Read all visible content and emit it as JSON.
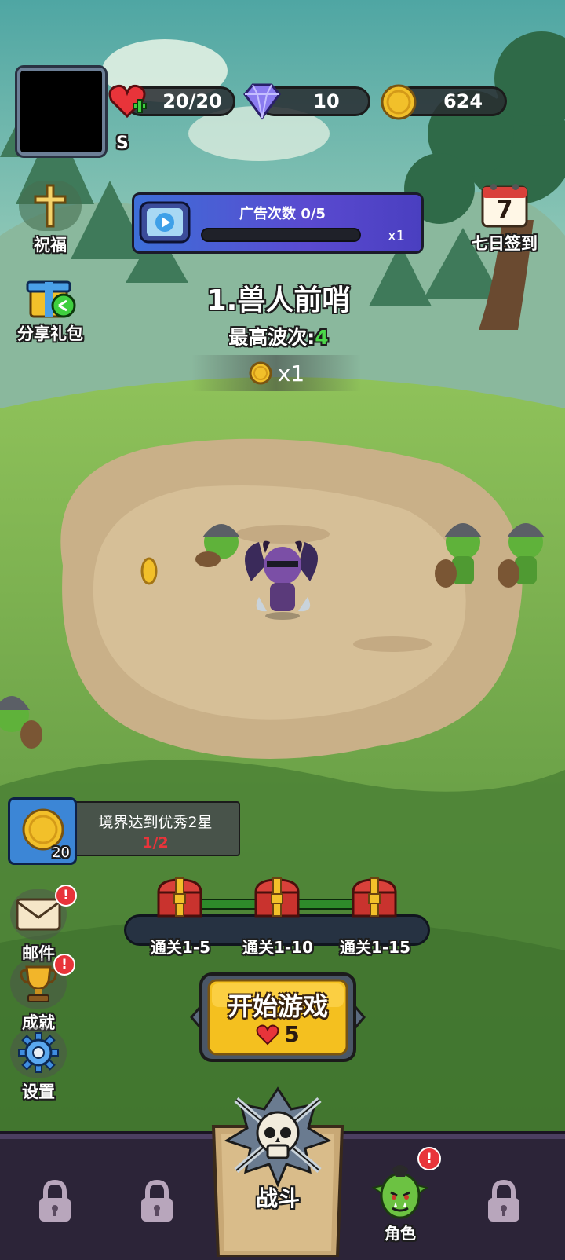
{
  "header": {
    "avatar_name": "S",
    "hearts": "20/20",
    "gems": "10",
    "coins": "624"
  },
  "ad_panel": {
    "title": "广告次数 0/5",
    "progress": 0,
    "multiplier": "x1"
  },
  "side_left": {
    "blessing_label": "祝福",
    "share_label": "分享礼包",
    "mail_label": "邮件",
    "achievement_label": "成就",
    "settings_label": "设置"
  },
  "side_right": {
    "signin_label": "七日签到",
    "signin_day": "7"
  },
  "stage": {
    "name": "1.兽人前哨",
    "best_wave_label": "最高波次:",
    "best_wave_value": "4",
    "coin_multiplier": "x1"
  },
  "quest": {
    "title": "境界达到优秀2星",
    "progress": "1/2",
    "reward_count": "20"
  },
  "milestones": [
    {
      "label": "通关1-5"
    },
    {
      "label": "通关1-10"
    },
    {
      "label": "通关1-15"
    }
  ],
  "start_button": {
    "label": "开始游戏",
    "cost": "5"
  },
  "bottom_nav": {
    "battle_label": "战斗",
    "character_label": "角色"
  },
  "colors": {
    "accent_yellow": "#f4c01f",
    "health_red": "#e8343a",
    "ad_panel_blue": "#4a4bd0",
    "wave_green": "#4cd84a",
    "nav_bg": "#2c2438"
  }
}
